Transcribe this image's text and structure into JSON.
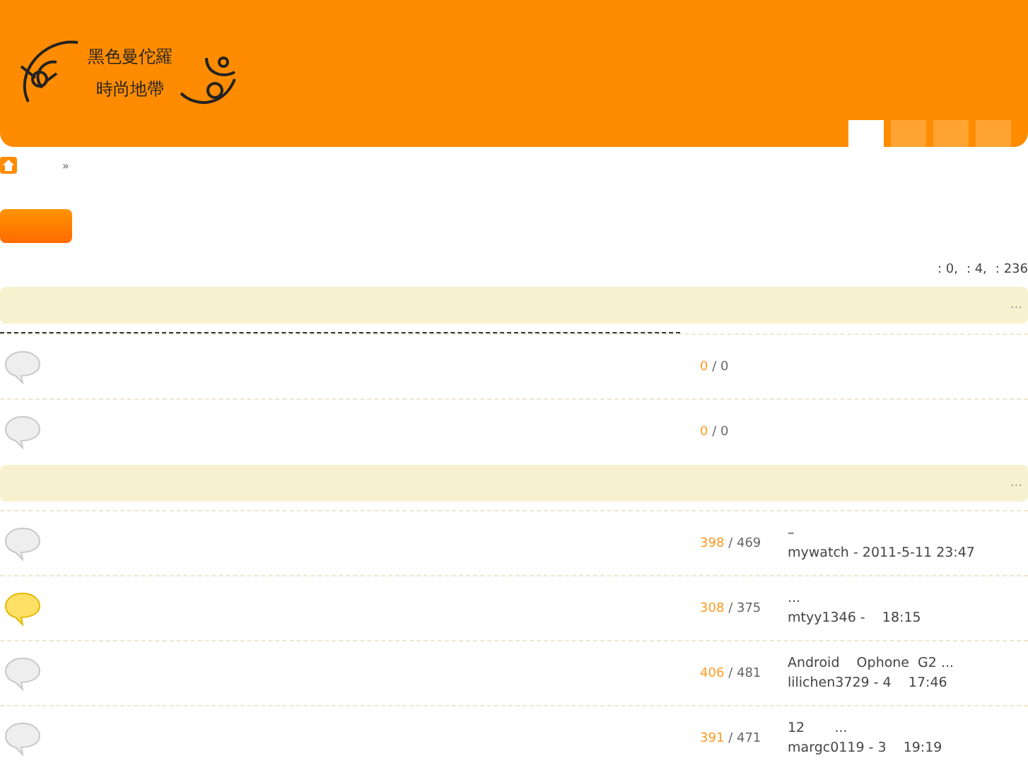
{
  "logo": {
    "line1": "黑色曼佗羅",
    "line2": "時尚地帶"
  },
  "nav_tabs": [
    {
      "selected": true
    },
    {
      "selected": false
    },
    {
      "selected": false
    },
    {
      "selected": false
    }
  ],
  "breadcrumb": {
    "separator": "»"
  },
  "stats": [
    ": 0,",
    ": 4,",
    ": 236"
  ],
  "sections": [
    {
      "more": "...",
      "divider": true,
      "forums": [
        {
          "new": false,
          "posts": "0",
          "sep": "/",
          "total": "0"
        },
        {
          "new": false,
          "posts": "0",
          "sep": "/",
          "total": "0"
        }
      ]
    },
    {
      "more": "...",
      "divider": false,
      "forums": [
        {
          "new": false,
          "posts": "398",
          "sep": "/",
          "total": "469",
          "last_title": "–",
          "last_author": "mywatch - 2011-5-11 23:47"
        },
        {
          "new": true,
          "posts": "308",
          "sep": "/",
          "total": "375",
          "last_title": "...",
          "last_author": "mtyy1346 -    18:15"
        },
        {
          "new": false,
          "posts": "406",
          "sep": "/",
          "total": "481",
          "last_title": "Android    Ophone  G2 ...",
          "last_author": "lilichen3729 - 4    17:46"
        },
        {
          "new": false,
          "posts": "391",
          "sep": "/",
          "total": "471",
          "last_title": "12       ...",
          "last_author": "margc0119 - 3    19:19"
        }
      ]
    }
  ]
}
